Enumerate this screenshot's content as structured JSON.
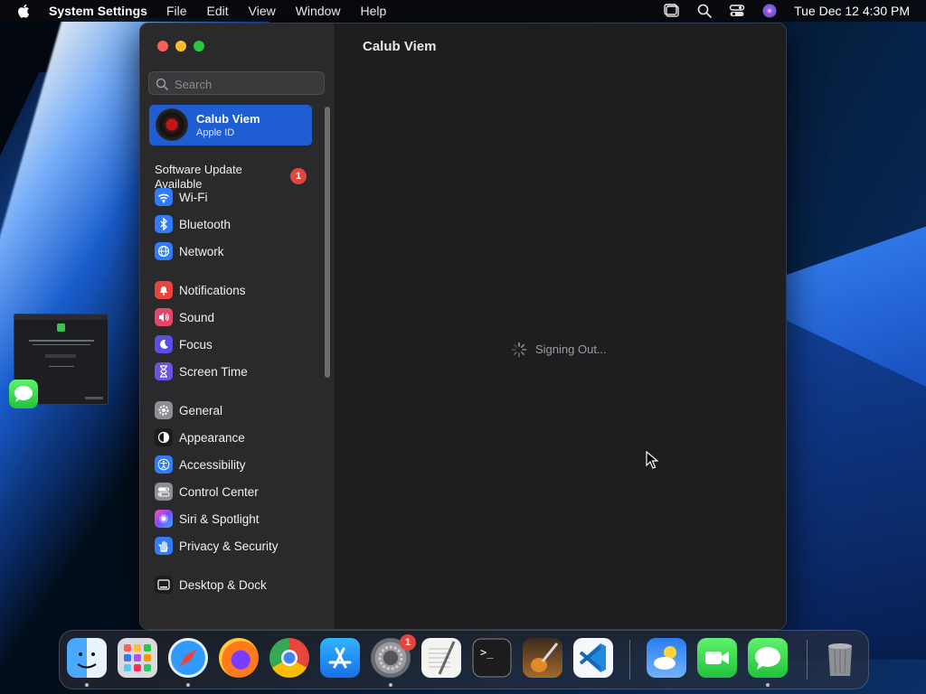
{
  "menubar": {
    "app_name": "System Settings",
    "menus": [
      "File",
      "Edit",
      "View",
      "Window",
      "Help"
    ],
    "datetime": "Tue Dec 12  4:30 PM"
  },
  "window": {
    "search_placeholder": "Search",
    "apple_id": {
      "name": "Calub Viem",
      "subtitle": "Apple ID"
    },
    "update": {
      "label": "Software Update Available",
      "badge": "1"
    },
    "sidebar": [
      {
        "label": "Wi-Fi",
        "icon": "wifi-icon",
        "color": "#2f7cf6"
      },
      {
        "label": "Bluetooth",
        "icon": "bluetooth-icon",
        "color": "#2f7cf6"
      },
      {
        "label": "Network",
        "icon": "globe-icon",
        "color": "#2f7cf6"
      },
      {
        "label": "Notifications",
        "icon": "bell-icon",
        "color": "#e8453c"
      },
      {
        "label": "Sound",
        "icon": "speaker-icon",
        "color": "#e8456a"
      },
      {
        "label": "Focus",
        "icon": "moon-icon",
        "color": "#5b4ee6"
      },
      {
        "label": "Screen Time",
        "icon": "hourglass-icon",
        "color": "#6a54e0"
      },
      {
        "label": "General",
        "icon": "gear-icon",
        "color": "#8e8e93"
      },
      {
        "label": "Appearance",
        "icon": "appearance-icon",
        "color": "#1c1c1e"
      },
      {
        "label": "Accessibility",
        "icon": "accessibility-icon",
        "color": "#2f7cf6"
      },
      {
        "label": "Control Center",
        "icon": "toggles-icon",
        "color": "#8e8e93"
      },
      {
        "label": "Siri & Spotlight",
        "icon": "siri-icon",
        "color": "#b04ad8"
      },
      {
        "label": "Privacy & Security",
        "icon": "hand-icon",
        "color": "#2f7cf6"
      },
      {
        "label": "Desktop & Dock",
        "icon": "dock-icon",
        "color": "#1c1c1e"
      }
    ],
    "content": {
      "title": "Calub Viem",
      "status": "Signing Out..."
    }
  },
  "dock": {
    "apps": [
      {
        "name": "finder",
        "icon": "finder-icon"
      },
      {
        "name": "launchpad",
        "icon": "launchpad-icon"
      },
      {
        "name": "safari",
        "icon": "safari-icon"
      },
      {
        "name": "firefox",
        "icon": "firefox-icon"
      },
      {
        "name": "chrome",
        "icon": "chrome-icon"
      },
      {
        "name": "app-store",
        "icon": "app-store-icon"
      },
      {
        "name": "system-settings",
        "icon": "system-settings-icon"
      },
      {
        "name": "textedit",
        "icon": "textedit-icon"
      },
      {
        "name": "terminal",
        "icon": "terminal-icon"
      },
      {
        "name": "garageband",
        "icon": "garageband-icon"
      },
      {
        "name": "vscode",
        "icon": "vscode-icon"
      },
      {
        "name": "weather",
        "icon": "weather-icon"
      },
      {
        "name": "facetime",
        "icon": "facetime-icon"
      },
      {
        "name": "messages",
        "icon": "messages-icon"
      },
      {
        "name": "trash",
        "icon": "trash-icon"
      }
    ],
    "settings_badge": "1"
  }
}
